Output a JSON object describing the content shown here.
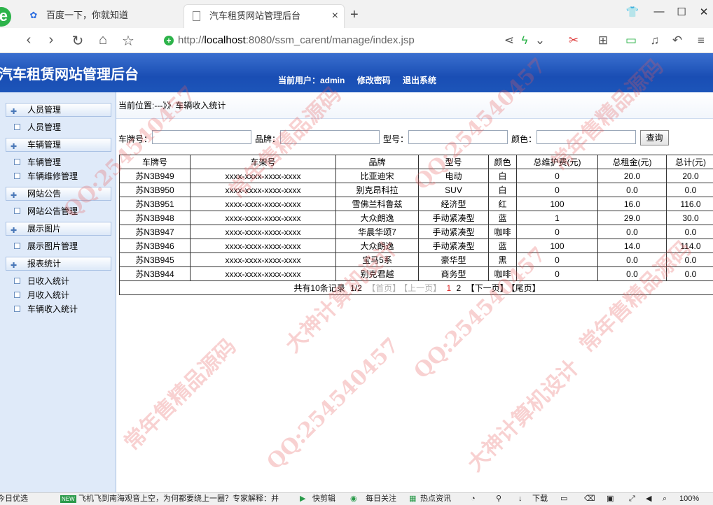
{
  "browser": {
    "logo": "e",
    "tabs": [
      {
        "icon": "✿",
        "title": "百度一下，你就知道"
      },
      {
        "icon": "",
        "title": "汽车租赁网站管理后台"
      }
    ],
    "tab_close": "×",
    "new_tab": "+",
    "url_prefix": "http://",
    "url_host": "localhost",
    "url_rest": ":8080/ssm_carent/manage/index.jsp",
    "zoom": "100%"
  },
  "header": {
    "title": "汽车租赁网站管理后台",
    "current_user_label": "当前用户：admin",
    "change_password": "修改密码",
    "logout": "退出系统"
  },
  "sidebar": {
    "groups": [
      {
        "label": "人员管理",
        "items": [
          "人员管理"
        ]
      },
      {
        "label": "车辆管理",
        "items": [
          "车辆管理",
          "车辆维修管理"
        ]
      },
      {
        "label": "网站公告",
        "items": [
          "网站公告管理"
        ]
      },
      {
        "label": "展示图片",
        "items": [
          "展示图片管理"
        ]
      },
      {
        "label": "报表统计",
        "items": [
          "日收入统计",
          "月收入统计",
          "车辆收入统计"
        ]
      }
    ]
  },
  "breadcrumb": "当前位置:---》》车辆收入统计",
  "search": {
    "plate_label": "车牌号：",
    "brand_label": "品牌：",
    "model_label": "型号：",
    "color_label": "颜色：",
    "button": "查询"
  },
  "table": {
    "headers": [
      "车牌号",
      "车架号",
      "品牌",
      "型号",
      "颜色",
      "总维护费(元)",
      "总租金(元)",
      "总计(元)"
    ],
    "rows": [
      [
        "苏N3B949",
        "xxxx-xxxx-xxxx-xxxx",
        "比亚迪宋",
        "电动",
        "白",
        "0",
        "20.0",
        "20.0"
      ],
      [
        "苏N3B950",
        "xxxx-xxxx-xxxx-xxxx",
        "别克昂科拉",
        "SUV",
        "白",
        "0",
        "0.0",
        "0.0"
      ],
      [
        "苏N3B951",
        "xxxx-xxxx-xxxx-xxxx",
        "雪佛兰科鲁兹",
        "经济型",
        "红",
        "100",
        "16.0",
        "116.0"
      ],
      [
        "苏N3B948",
        "xxxx-xxxx-xxxx-xxxx",
        "大众朗逸",
        "手动紧凑型",
        "蓝",
        "1",
        "29.0",
        "30.0"
      ],
      [
        "苏N3B947",
        "xxxx-xxxx-xxxx-xxxx",
        "华晨华颂7",
        "手动紧凑型",
        "咖啡",
        "0",
        "0.0",
        "0.0"
      ],
      [
        "苏N3B946",
        "xxxx-xxxx-xxxx-xxxx",
        "大众朗逸",
        "手动紧凑型",
        "蓝",
        "100",
        "14.0",
        "114.0"
      ],
      [
        "苏N3B945",
        "xxxx-xxxx-xxxx-xxxx",
        "宝马5系",
        "豪华型",
        "黑",
        "0",
        "0.0",
        "0.0"
      ],
      [
        "苏N3B944",
        "xxxx-xxxx-xxxx-xxxx",
        "别克君越",
        "商务型",
        "咖啡",
        "0",
        "0.0",
        "0.0"
      ]
    ]
  },
  "pager": {
    "summary": "共有10条记录",
    "page": "1/2",
    "first": "【首页】",
    "prev": "【上一页】",
    "page1": "1",
    "page2": "2",
    "next": "【下一页】",
    "last": "【尾页】"
  },
  "watermarks": {
    "text_a": "QQ:254540457",
    "text_b": "常年售精品源码",
    "text_c": "大神计算机设计"
  },
  "taskbar": {
    "left": "今日优选",
    "badge": "NEW",
    "news": "飞机飞到南海观音上空，为何都要绕上一圈？专家解释：并",
    "kuaijian": "快剪辑",
    "daily": "每日关注",
    "hot": "热点资讯",
    "download": "下载",
    "zoom": "100%"
  }
}
